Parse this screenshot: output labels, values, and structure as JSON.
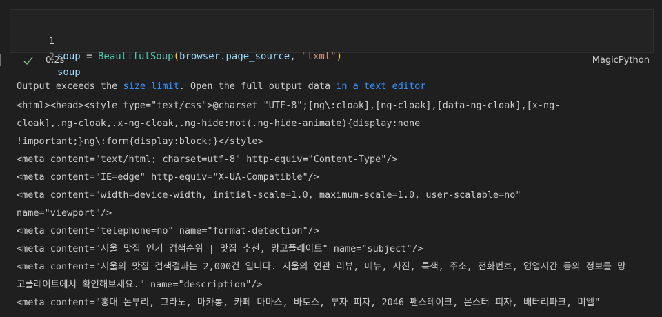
{
  "cell": {
    "lines": [
      {
        "number": "1",
        "tokens": {
          "var": "soup",
          "eq": " = ",
          "cls": "BeautifulSoup",
          "open": "(",
          "arg": "browser.page_source",
          "comma": ", ",
          "str": "\"lxml\"",
          "close": ")"
        }
      },
      {
        "number": "2",
        "tokens": {
          "var": "soup"
        }
      }
    ],
    "status": {
      "time": "0.2s",
      "kernel": "MagicPython"
    }
  },
  "output": {
    "notice": {
      "prefix": "Output exceeds the ",
      "link1": "size limit",
      "middle": ". Open the full output data ",
      "link2": "in a text editor"
    },
    "lines": [
      "<html><head><style type=\"text/css\">@charset \"UTF-8\";[ng\\:cloak],[ng-cloak],[data-ng-cloak],[x-ng-",
      "cloak],.ng-cloak,.x-ng-cloak,.ng-hide:not(.ng-hide-animate){display:none",
      "!important;}ng\\:form{display:block;}</style>",
      "<meta content=\"text/html; charset=utf-8\" http-equiv=\"Content-Type\"/>",
      "<meta content=\"IE=edge\" http-equiv=\"X-UA-Compatible\"/>",
      "<meta content=\"width=device-width, initial-scale=1.0, maximum-scale=1.0, user-scalable=no\"",
      "name=\"viewport\"/>",
      "<meta content=\"telephone=no\" name=\"format-detection\"/>",
      "<meta content=\"서울 맛집 인기 검색순위 | 맛집 추천, 망고플레이트\" name=\"subject\"/>",
      "<meta content=\"서울의 맛집 검색결과는 2,000건 입니다. 서울의 연관 리뷰, 메뉴, 사진, 특색, 주소, 전화번호, 영업시간 등의 정보를 망",
      "고플레이트에서 확인해보세요.\" name=\"description\"/>",
      "<meta content=\"홍대 돈부리, 그라노, 마카롱, 카페 마마스, 바토스, 부자 피자, 2046 팬스테이크, 몬스터 피자, 배터리파크, 미엘\""
    ]
  }
}
